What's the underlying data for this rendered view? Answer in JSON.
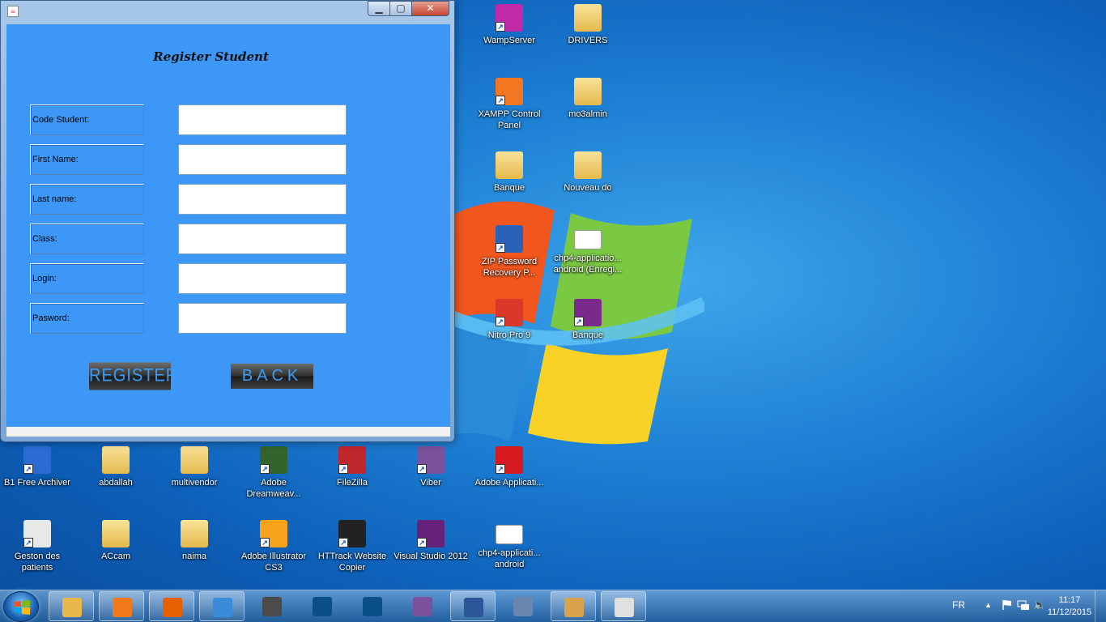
{
  "window": {
    "title": "",
    "form_title": "Register Student",
    "fields": [
      {
        "label": "Code Student:",
        "value": ""
      },
      {
        "label": "First Name:",
        "value": ""
      },
      {
        "label": "Last name:",
        "value": ""
      },
      {
        "label": "Class:",
        "value": ""
      },
      {
        "label": "Login:",
        "value": ""
      },
      {
        "label": "Pasword:",
        "value": ""
      }
    ],
    "register_label": "REGISTER",
    "back_label": "BACK"
  },
  "desktop": {
    "icons": [
      {
        "label": "WampServer",
        "icon": "wampserver-icon",
        "color": "#c02aa8"
      },
      {
        "label": "DRIVERS",
        "icon": "folder-icon"
      },
      {
        "label": "XAMPP Control Panel",
        "icon": "xampp-icon",
        "color": "#f37721"
      },
      {
        "label": "mo3almin",
        "icon": "folder-icon"
      },
      {
        "label": "Banque",
        "icon": "folder-icon"
      },
      {
        "label": "Nouveau do",
        "icon": "folder-icon"
      },
      {
        "label": "ZIP Password Recovery P...",
        "icon": "zip-password-icon",
        "color": "#2a62b8"
      },
      {
        "label": "chp4-applicatio... android (Enregi...",
        "icon": "document-icon"
      },
      {
        "label": "Nitro Pro 9",
        "icon": "nitro-icon",
        "color": "#d9382a"
      },
      {
        "label": "Banque",
        "icon": "winrar-icon",
        "color": "#7a2a8a"
      },
      {
        "label": "B1 Free Archiver",
        "icon": "b1-archiver-icon",
        "color": "#2b6cd2"
      },
      {
        "label": "abdallah",
        "icon": "folder-icon"
      },
      {
        "label": "multivendor",
        "icon": "folder-icon"
      },
      {
        "label": "Adobe Dreamweav...",
        "icon": "dreamweaver-icon",
        "color": "#35632d"
      },
      {
        "label": "FileZilla",
        "icon": "filezilla-icon",
        "color": "#c0272d"
      },
      {
        "label": "Viber",
        "icon": "viber-icon",
        "color": "#7b519d"
      },
      {
        "label": "Adobe Applicati...",
        "icon": "adobe-app-icon",
        "color": "#d71920"
      },
      {
        "label": "Geston des patients",
        "icon": "app-icon",
        "color": "#e8e8e8"
      },
      {
        "label": "ACcam",
        "icon": "folder-icon"
      },
      {
        "label": "naima",
        "icon": "folder-icon"
      },
      {
        "label": "Adobe Illustrator CS3",
        "icon": "illustrator-icon",
        "color": "#f7a21b"
      },
      {
        "label": "HTTrack Website Copier",
        "icon": "httrack-icon",
        "color": "#222222"
      },
      {
        "label": "Visual Studio 2012",
        "icon": "visual-studio-icon",
        "color": "#68217a"
      },
      {
        "label": "chp4-applicati... android",
        "icon": "document-icon"
      }
    ]
  },
  "taskbar": {
    "apps": [
      {
        "icon": "explorer-icon",
        "color": "#e8b84a"
      },
      {
        "icon": "media-player-icon",
        "color": "#f07a1a"
      },
      {
        "icon": "firefox-icon",
        "color": "#e66000"
      },
      {
        "icon": "chrome-icon",
        "color": "#3b8cd8"
      },
      {
        "icon": "sublime-icon",
        "color": "#4b4b4b"
      },
      {
        "icon": "photoshop-icon",
        "color": "#0b4f8a"
      },
      {
        "icon": "photoshop-icon-2",
        "color": "#0b4f8a"
      },
      {
        "icon": "viber-icon",
        "color": "#7b519d"
      },
      {
        "icon": "word-icon",
        "color": "#2b579a"
      },
      {
        "icon": "virtualbox-icon",
        "color": "#6a86b0"
      },
      {
        "icon": "paint-icon",
        "color": "#d8a34a"
      },
      {
        "icon": "java-icon",
        "color": "#e0e0e0"
      }
    ],
    "language": "FR",
    "time": "11:17",
    "date": "11/12/2015"
  }
}
